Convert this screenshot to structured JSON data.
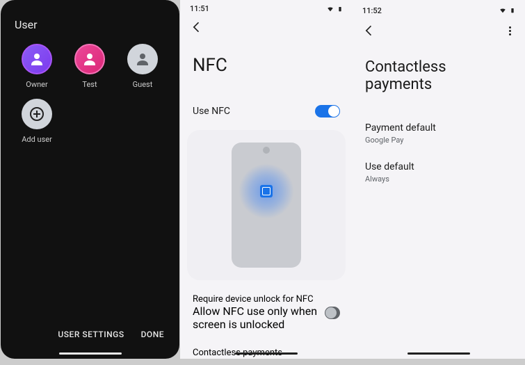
{
  "panel1": {
    "title": "User",
    "users": [
      {
        "label": "Owner",
        "kind": "owner"
      },
      {
        "label": "Test",
        "kind": "test"
      },
      {
        "label": "Guest",
        "kind": "guest"
      },
      {
        "label": "Add user",
        "kind": "add"
      }
    ],
    "actions": {
      "settings": "USER SETTINGS",
      "done": "DONE"
    }
  },
  "panel2": {
    "time": "11:51",
    "title": "NFC",
    "use_nfc": {
      "label": "Use NFC",
      "on": true
    },
    "require_unlock": {
      "label": "Require device unlock for NFC",
      "sub": "Allow NFC use only when screen is unlocked",
      "on": false
    },
    "contactless_label": "Contactless payments"
  },
  "panel3": {
    "time": "11:52",
    "title": "Contactless payments",
    "payment_default": {
      "label": "Payment default",
      "value": "Google Pay"
    },
    "use_default": {
      "label": "Use default",
      "value": "Always"
    }
  }
}
